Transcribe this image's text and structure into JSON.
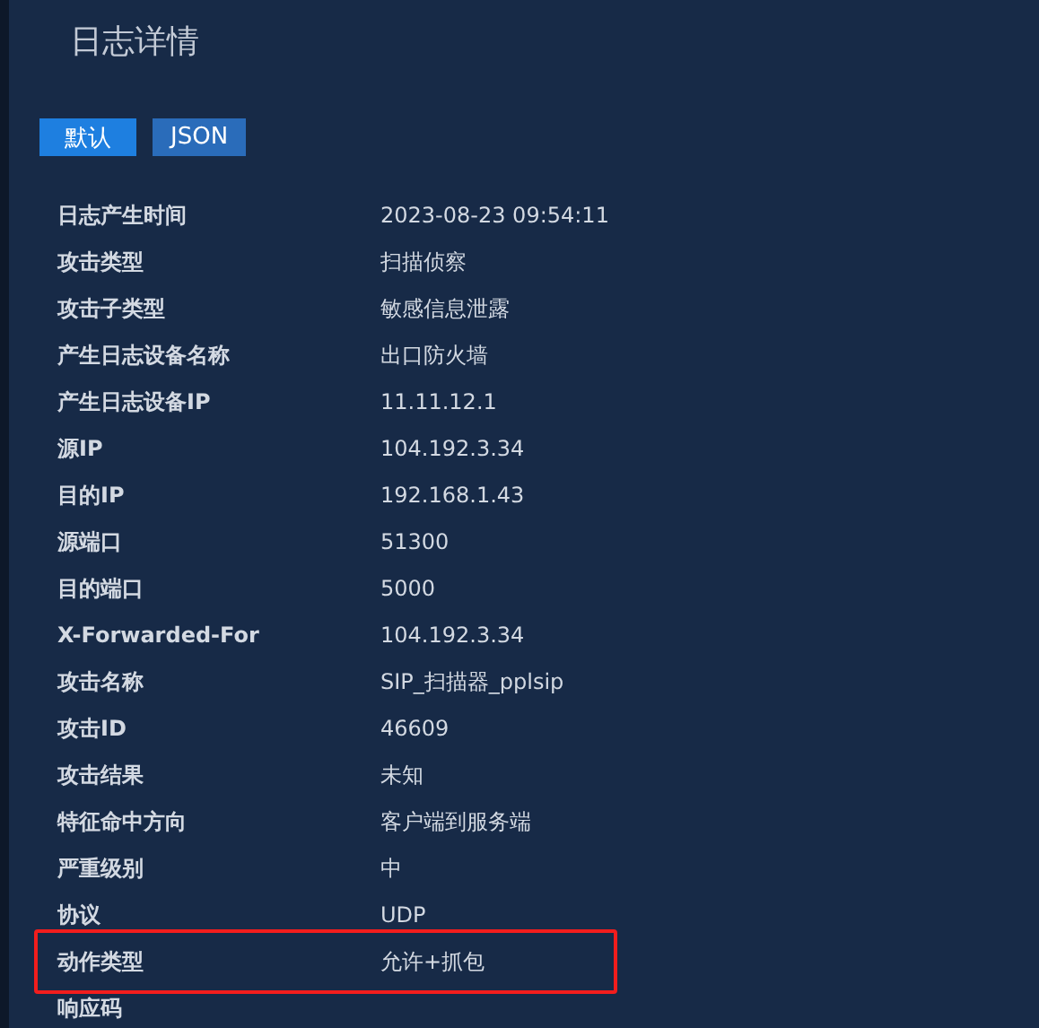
{
  "title": "日志详情",
  "tabs": [
    {
      "label": "默认",
      "selected": true
    },
    {
      "label": "JSON",
      "selected": false
    }
  ],
  "fields": [
    {
      "label": "日志产生时间",
      "value": "2023-08-23 09:54:11",
      "highlighted": false
    },
    {
      "label": "攻击类型",
      "value": "扫描侦察",
      "highlighted": false
    },
    {
      "label": "攻击子类型",
      "value": "敏感信息泄露",
      "highlighted": false
    },
    {
      "label": "产生日志设备名称",
      "value": "出口防火墙",
      "highlighted": false
    },
    {
      "label": "产生日志设备IP",
      "value": "11.11.12.1",
      "highlighted": false
    },
    {
      "label": "源IP",
      "value": "104.192.3.34",
      "highlighted": false
    },
    {
      "label": "目的IP",
      "value": "192.168.1.43",
      "highlighted": false
    },
    {
      "label": "源端口",
      "value": "51300",
      "highlighted": false
    },
    {
      "label": "目的端口",
      "value": "5000",
      "highlighted": false
    },
    {
      "label": "X-Forwarded-For",
      "value": "104.192.3.34",
      "highlighted": false
    },
    {
      "label": "攻击名称",
      "value": "SIP_扫描器_pplsip",
      "highlighted": false
    },
    {
      "label": "攻击ID",
      "value": "46609",
      "highlighted": false
    },
    {
      "label": "攻击结果",
      "value": "未知",
      "highlighted": false
    },
    {
      "label": "特征命中方向",
      "value": "客户端到服务端",
      "highlighted": false
    },
    {
      "label": "严重级别",
      "value": "中",
      "highlighted": false
    },
    {
      "label": "协议",
      "value": "UDP",
      "highlighted": false
    },
    {
      "label": "动作类型",
      "value": "允许+抓包",
      "highlighted": true
    },
    {
      "label": "响应码",
      "highlighted": false
    }
  ]
}
